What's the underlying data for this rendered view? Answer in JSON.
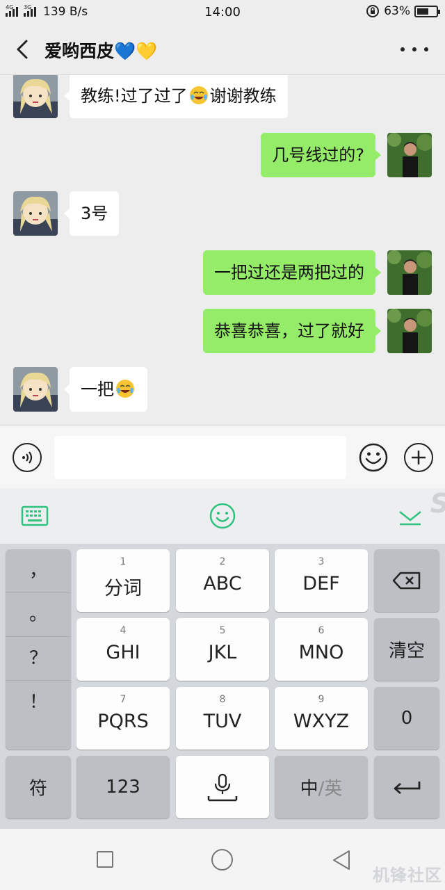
{
  "status_bar": {
    "network_1": "4G",
    "network_2": "3G",
    "speed": "139 B/s",
    "time": "14:00",
    "battery_text": "63%",
    "battery_level": 0.63
  },
  "header": {
    "title": "爱哟西皮💙💛",
    "icons": {
      "back": "chevron-left-icon",
      "more": "more-horizontal-icon"
    }
  },
  "messages": [
    {
      "side": "left",
      "parts": [
        "教练!过了过了",
        "[emoji:laugh-cry]",
        "谢谢教练"
      ]
    },
    {
      "side": "right",
      "parts": [
        "几号线过的?"
      ]
    },
    {
      "side": "left",
      "parts": [
        "3号"
      ]
    },
    {
      "side": "right",
      "parts": [
        "一把过还是两把过的"
      ]
    },
    {
      "side": "right",
      "parts": [
        "恭喜恭喜，过了就好"
      ]
    },
    {
      "side": "left",
      "parts": [
        "一把",
        "[emoji:laugh-cry]"
      ]
    }
  ],
  "msg_text": {
    "m1_a": "教练!过了过了",
    "m1_b": "谢谢教练",
    "m2": "几号线过的?",
    "m3": "3号",
    "m4": "一把过还是两把过的",
    "m5": "恭喜恭喜，过了就好",
    "m6": "一把"
  },
  "input_bar": {
    "value": "",
    "icons": {
      "voice": "voice-icon",
      "emoji": "emoji-icon",
      "plus": "plus-icon"
    }
  },
  "ime_toolbar": {
    "icons": {
      "keyboard": "keyboard-icon",
      "emoji": "smile-icon",
      "collapse": "collapse-icon"
    },
    "watermark": "S"
  },
  "keyboard": {
    "punctuation": [
      "，",
      "。",
      "？",
      "！"
    ],
    "keys": [
      {
        "num": "1",
        "label": "分词"
      },
      {
        "num": "2",
        "label": "ABC"
      },
      {
        "num": "3",
        "label": "DEF"
      },
      {
        "num": "4",
        "label": "GHI"
      },
      {
        "num": "5",
        "label": "JKL"
      },
      {
        "num": "6",
        "label": "MNO"
      },
      {
        "num": "7",
        "label": "PQRS"
      },
      {
        "num": "8",
        "label": "TUV"
      },
      {
        "num": "9",
        "label": "WXYZ"
      }
    ],
    "clear": "清空",
    "zero": "0",
    "symbols": "符",
    "numbers": "123",
    "lang_zh": "中",
    "lang_sep": "/",
    "lang_en": "英",
    "accent_color": "#2ec27e"
  },
  "watermark_bottom": "机锋社区"
}
